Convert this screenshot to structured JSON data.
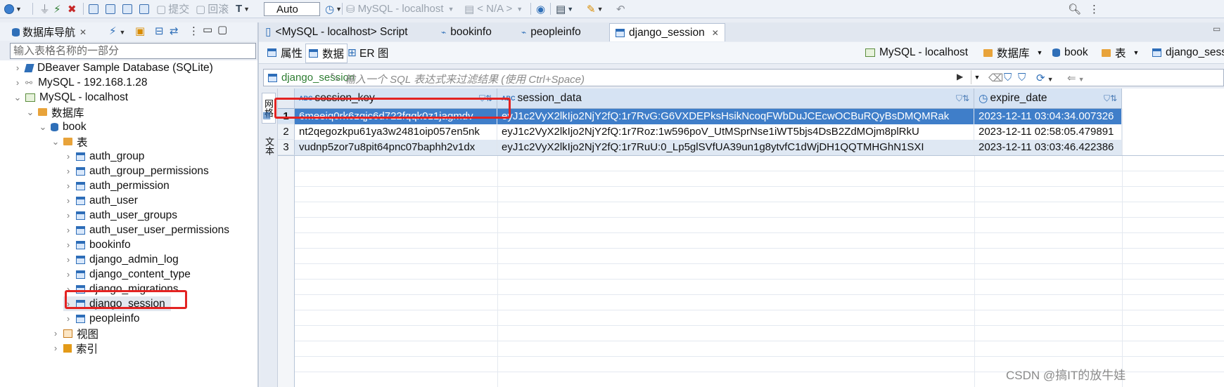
{
  "toolbar": {
    "commit": "提交",
    "rollback": "回滚",
    "mode": "Auto",
    "connection": "MySQL - localhost",
    "schema": "< N/A >"
  },
  "navigator": {
    "title": "数据库导航",
    "filter_placeholder": "输入表格名称的一部分",
    "tree": [
      {
        "label": "DBeaver Sample Database (SQLite)"
      },
      {
        "label": "MySQL - 192.168.1.28"
      },
      {
        "label": "MySQL - localhost"
      },
      {
        "label": "数据库"
      },
      {
        "label": "book"
      },
      {
        "label": "表"
      },
      {
        "label": "auth_group"
      },
      {
        "label": "auth_group_permissions"
      },
      {
        "label": "auth_permission"
      },
      {
        "label": "auth_user"
      },
      {
        "label": "auth_user_groups"
      },
      {
        "label": "auth_user_user_permissions"
      },
      {
        "label": "bookinfo"
      },
      {
        "label": "django_admin_log"
      },
      {
        "label": "django_content_type"
      },
      {
        "label": "django_migrations"
      },
      {
        "label": "django_session"
      },
      {
        "label": "peopleinfo"
      },
      {
        "label": "视图"
      },
      {
        "label": "索引"
      }
    ]
  },
  "editor": {
    "tabs": [
      "<MySQL - localhost> Script",
      "bookinfo",
      "peopleinfo",
      "django_session"
    ],
    "subtabs": [
      "属性",
      "数据",
      "ER 图"
    ],
    "breadcrumb": [
      "MySQL - localhost",
      "数据库",
      "book",
      "表",
      "django_sess"
    ],
    "table_name": "django_session",
    "sql_placeholder": "输入一个 SQL 表达式来过滤结果 (使用 Ctrl+Space)",
    "side_tabs": [
      "网格",
      "文本"
    ]
  },
  "grid": {
    "columns": [
      "session_key",
      "session_data",
      "expire_date"
    ],
    "rows": [
      {
        "num": "1",
        "session_key": "6meeiq0rk6zqjc6d722fqqk0z1jagmdv",
        "session_data": "eyJ1c2VyX2lkIjo2NjY2fQ:1r7RvG:G6VXDEPksHsikNcoqFWbDuJCEcwOCBuRQyBsDMQMRak",
        "expire_date": "2023-12-11 03:04:34.007326"
      },
      {
        "num": "2",
        "session_key": "nt2qegozkpu61ya3w2481oip057en5nk",
        "session_data": "eyJ1c2VyX2lkIjo2NjY2fQ:1r7Roz:1w596poV_UtMSprNse1iWT5bjs4DsB2ZdMOjm8plRkU",
        "expire_date": "2023-12-11 02:58:05.479891"
      },
      {
        "num": "3",
        "session_key": "vudnp5zor7u8pit64pnc07baphh2v1dx",
        "session_data": "eyJ1c2VyX2lkIjo2NjY2fQ:1r7RuU:0_Lp5glSVfUA39un1g8ytvfC1dWjDH1QQTMHGhN1SXI",
        "expire_date": "2023-12-11 03:03:46.422386"
      }
    ]
  },
  "watermark": "CSDN @搞IT的放牛娃"
}
